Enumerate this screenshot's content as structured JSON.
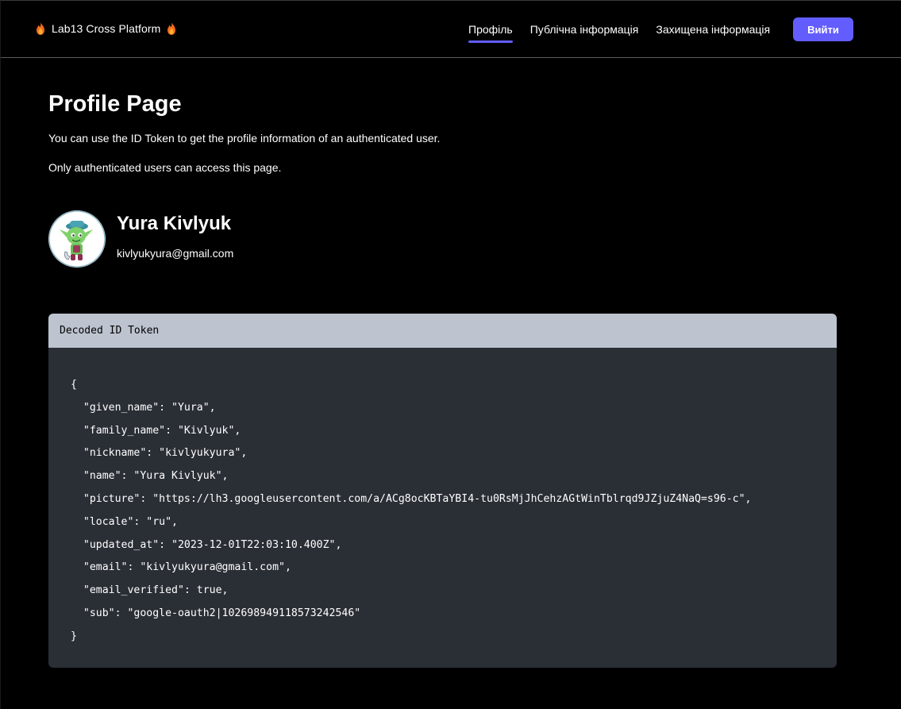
{
  "nav": {
    "brand": "Lab13 Cross Platform",
    "brand_icon": "fire-icon",
    "links": [
      {
        "label": "Профіль",
        "active": true
      },
      {
        "label": "Публічна інформація",
        "active": false
      },
      {
        "label": "Захищена інформація",
        "active": false
      }
    ],
    "logout_label": "Вийти",
    "accent_color": "#635dff"
  },
  "page": {
    "title": "Profile Page",
    "description_1": "You can use the ID Token to get the profile information of an authenticated user.",
    "description_2": "Only authenticated users can access this page."
  },
  "profile": {
    "name": "Yura Kivlyuk",
    "email": "kivlyukyura@gmail.com",
    "avatar": "cartoon-avatar"
  },
  "token": {
    "header": "Decoded ID Token",
    "lines": [
      "{",
      "  \"given_name\": \"Yura\",",
      "  \"family_name\": \"Kivlyuk\",",
      "  \"nickname\": \"kivlyukyura\",",
      "  \"name\": \"Yura Kivlyuk\",",
      "  \"picture\": \"https://lh3.googleusercontent.com/a/ACg8ocKBTaYBI4-tu0RsMjJhCehzAGtWinTblrqd9JZjuZ4NaQ=s96-c\",",
      "  \"locale\": \"ru\",",
      "  \"updated_at\": \"2023-12-01T22:03:10.400Z\",",
      "  \"email\": \"kivlyukyura@gmail.com\",",
      "  \"email_verified\": true,",
      "  \"sub\": \"google-oauth2|102698949118573242546\"",
      "}"
    ]
  }
}
